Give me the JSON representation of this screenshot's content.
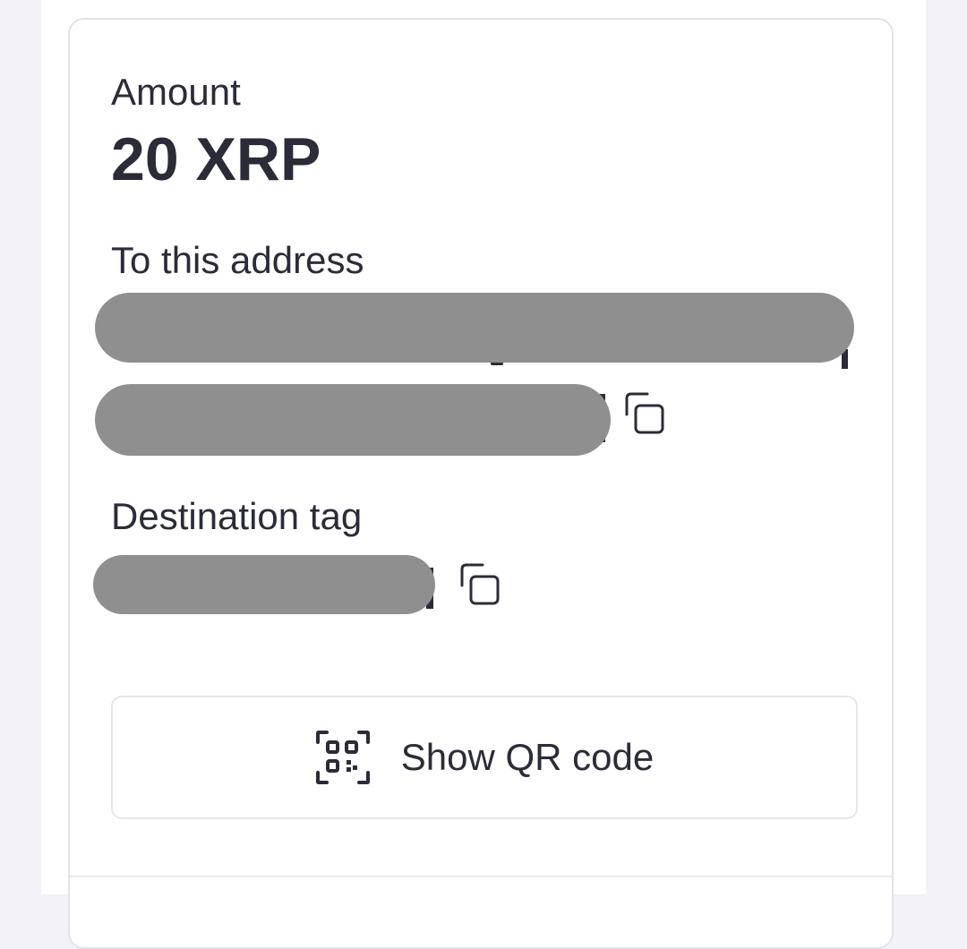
{
  "payment": {
    "amount_label": "Amount",
    "amount_value": "20 XRP",
    "address_label": "To this address",
    "destination_tag_label": "Destination tag"
  },
  "qr_button": {
    "label": "Show QR code",
    "icon": "qr-code-icon"
  },
  "copy_icon": "copy-icon",
  "colors": {
    "text": "#2b2c38",
    "redaction": "#8f8f8f",
    "border": "#e2e2e8",
    "background": "#f3f2f8"
  }
}
